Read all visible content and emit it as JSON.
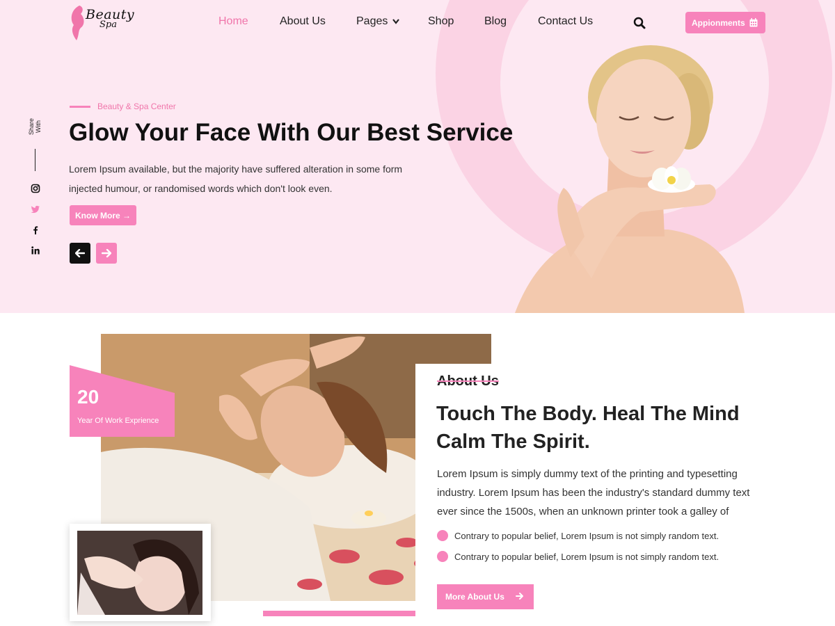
{
  "brand": {
    "logo_line1": "Beauty",
    "logo_line2": "Spa",
    "accent_color": "#f783bb"
  },
  "nav": {
    "items": [
      {
        "label": "Home",
        "active": true
      },
      {
        "label": "About Us"
      },
      {
        "label": "Pages",
        "icon": "chevron-down-icon"
      },
      {
        "label": "Shop"
      },
      {
        "label": "Blog"
      },
      {
        "label": "Contact Us"
      }
    ],
    "search_icon": "search-icon",
    "appointment_label": "Appionments",
    "appointment_icon": "calendar-icon"
  },
  "share": {
    "label": "Share With",
    "icons": [
      "instagram-icon",
      "twitter-icon",
      "facebook-icon",
      "linkedin-icon"
    ]
  },
  "hero": {
    "tag": "Beauty & Spa Center",
    "title": "Glow Your Face With Our Best Service",
    "description": "Lorem Ipsum available, but the majority have suffered alteration in some form injected humour, or randomised words which don't look even.",
    "button_label": "Know More →",
    "prev_icon": "arrow-left-icon",
    "next_icon": "arrow-right-icon"
  },
  "about": {
    "experience_number": "20",
    "experience_label": "Year Of Work Exprience",
    "label": "About Us",
    "title": "Touch The Body. Heal The Mind Calm The Spirit.",
    "description": "Lorem Ipsum is simply dummy text of the printing and typesetting industry. Lorem Ipsum has been the industry's standard dummy text ever since the 1500s, when an unknown printer took a galley of",
    "bullets": [
      "Contrary to popular belief, Lorem Ipsum is not simply random text.",
      "Contrary to popular belief, Lorem Ipsum is not simply random text."
    ],
    "button_label": "More About Us"
  }
}
